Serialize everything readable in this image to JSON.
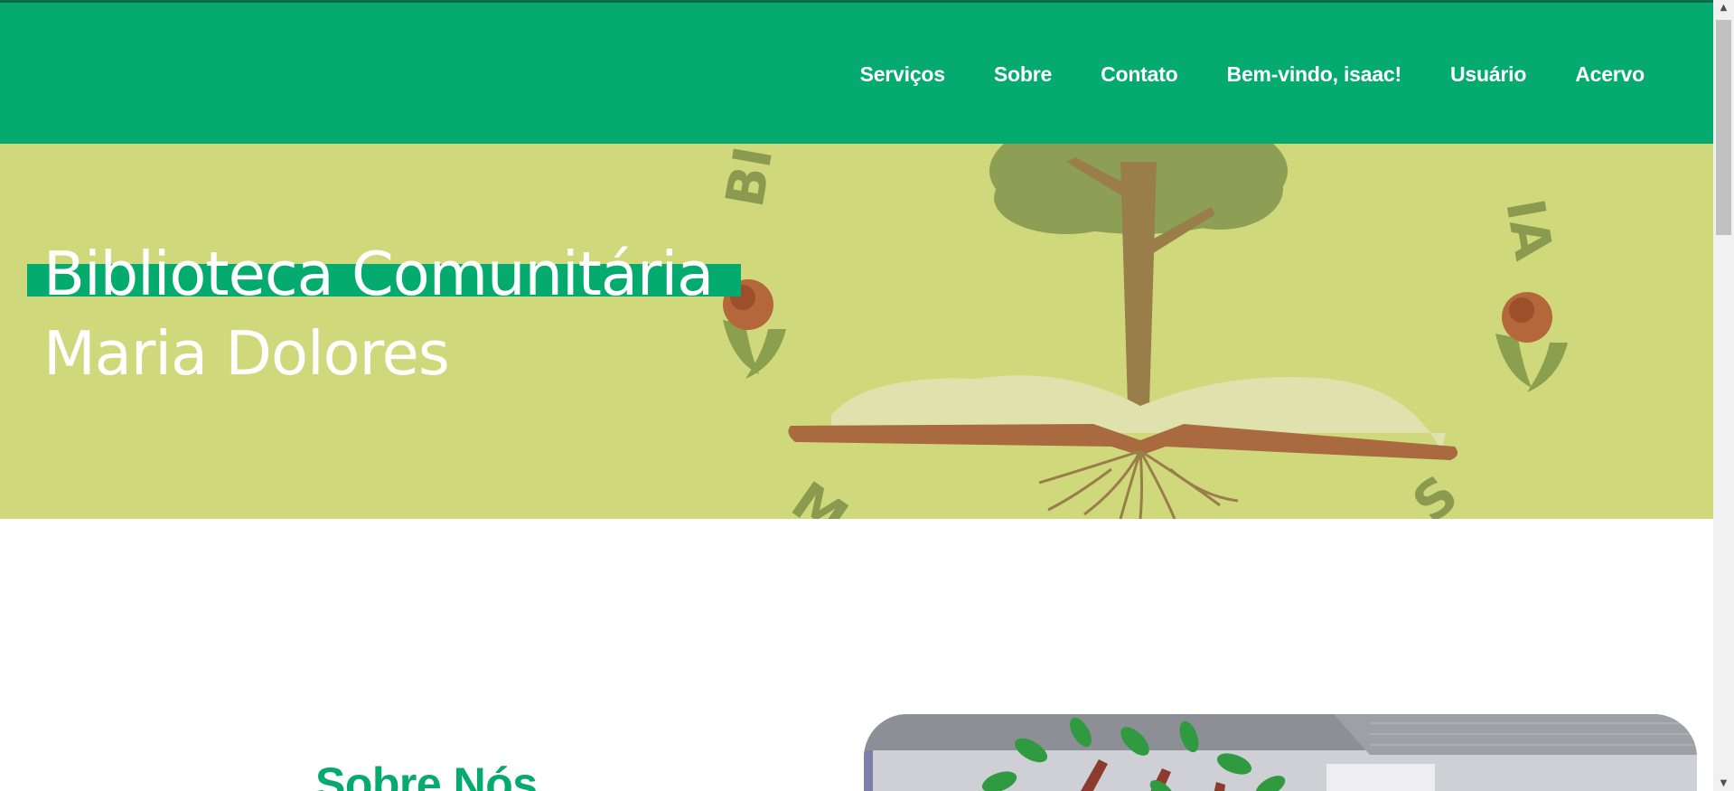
{
  "nav": {
    "items": [
      {
        "label": "Serviços"
      },
      {
        "label": "Sobre"
      },
      {
        "label": "Contato"
      },
      {
        "label": "Bem-vindo, isaac!"
      },
      {
        "label": "Usuário"
      },
      {
        "label": "Acervo"
      }
    ]
  },
  "hero": {
    "title_line1": "Biblioteca Comunitária",
    "title_line2": "Maria Dolores",
    "logo_letters": "BIBLIOTECA COMUNITÁRIA MARIA DOLORES"
  },
  "about": {
    "title": "Sobre Nós"
  },
  "colors": {
    "brand_green": "#05aa6e",
    "hero_background": "#cfd97b",
    "white": "#ffffff"
  },
  "icons": {
    "scroll_up": "▲",
    "scroll_down": "▼"
  }
}
